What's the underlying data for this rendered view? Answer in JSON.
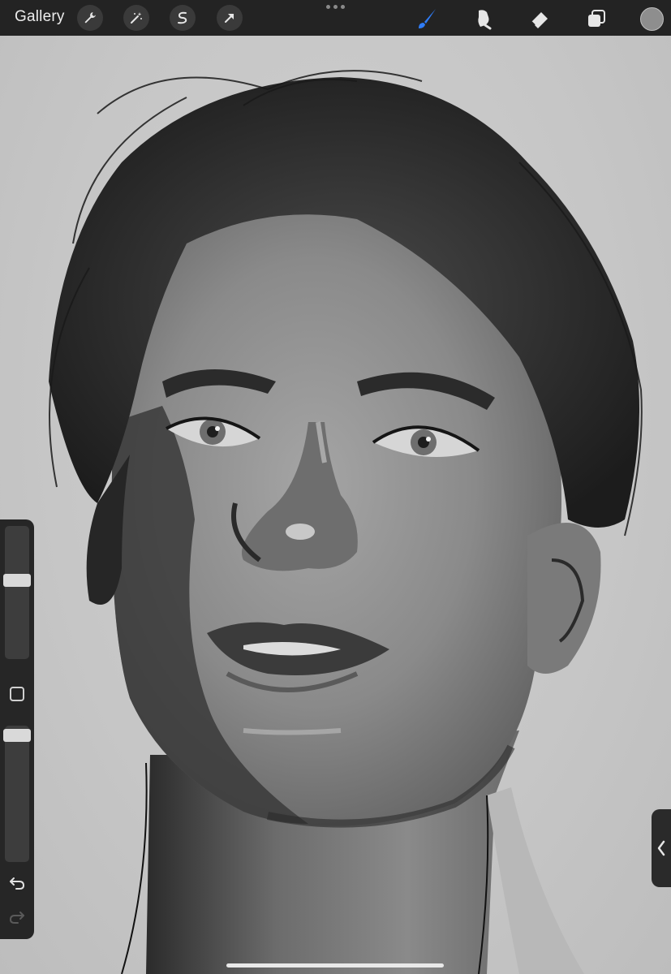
{
  "toolbar": {
    "gallery_label": "Gallery",
    "left_tools": [
      "wrench-icon",
      "magic-wand-icon",
      "selection-icon",
      "transform-arrow-icon"
    ],
    "right_tools": [
      "brush-icon",
      "smudge-icon",
      "eraser-icon",
      "layers-icon"
    ],
    "active_tool": "brush-icon",
    "accent_color": "#2f7cf6",
    "current_color": "#8e8e8e"
  },
  "sidebar": {
    "brush_size_level": 0.4,
    "opacity_level": 0.95,
    "icons": [
      "modify-square-icon",
      "undo-icon",
      "redo-icon"
    ]
  },
  "canvas": {
    "subject": "portrait-illustration",
    "palette": [
      "#c9c9c9",
      "#7a7a7a",
      "#4a4a4a",
      "#1f1f1f"
    ]
  }
}
